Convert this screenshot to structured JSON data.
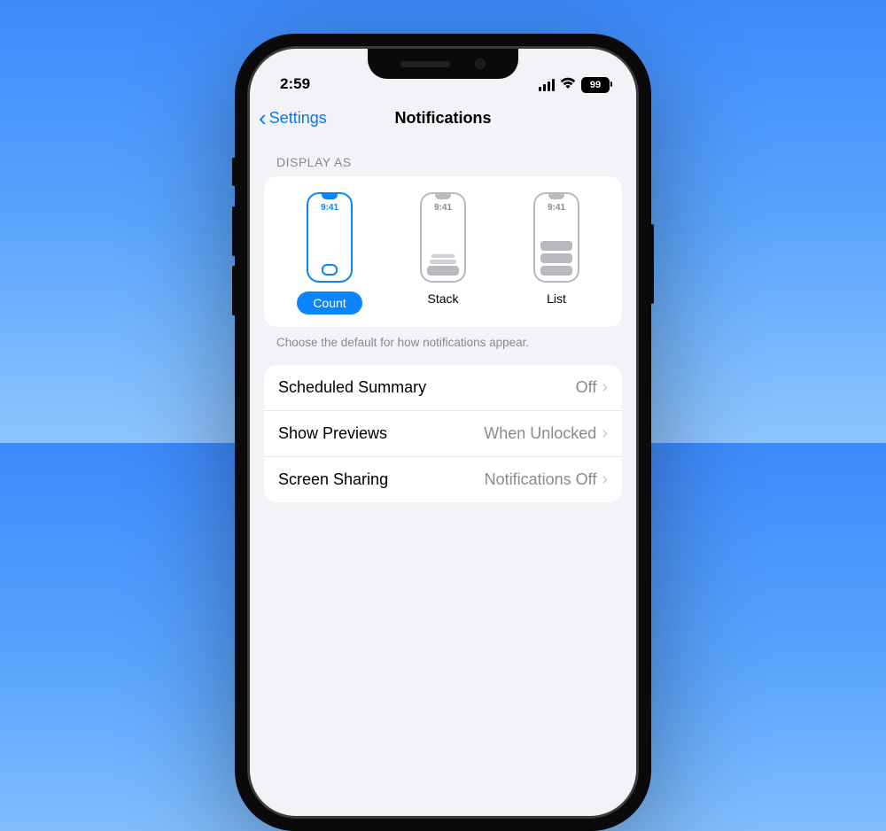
{
  "status": {
    "time": "2:59",
    "battery": "99"
  },
  "nav": {
    "back": "Settings",
    "title": "Notifications"
  },
  "displayAs": {
    "header": "DISPLAY AS",
    "miniTime": "9:41",
    "options": {
      "count": "Count",
      "stack": "Stack",
      "list": "List"
    },
    "footer": "Choose the default for how notifications appear."
  },
  "rows": {
    "scheduled": {
      "title": "Scheduled Summary",
      "value": "Off"
    },
    "previews": {
      "title": "Show Previews",
      "value": "When Unlocked"
    },
    "screenShare": {
      "title": "Screen Sharing",
      "value": "Notifications Off"
    }
  }
}
